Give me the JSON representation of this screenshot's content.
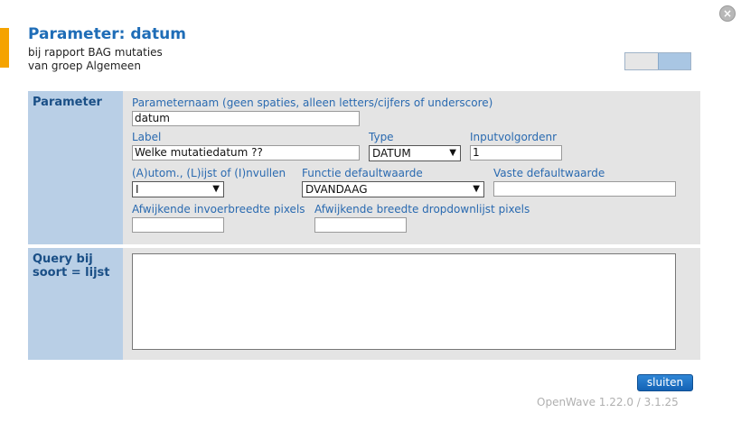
{
  "dialog": {
    "title": "Parameter: datum",
    "subtitle_line1": "bij rapport BAG mutaties",
    "subtitle_line2": "van groep Algemeen",
    "close_glyph": "×"
  },
  "parameter_section": {
    "heading": "Parameter",
    "name_label": "Parameternaam (geen spaties, alleen letters/cijfers of underscore)",
    "name_value": "datum",
    "label_label": "Label",
    "label_value": "Welke mutatiedatum ??",
    "type_label": "Type",
    "type_value": "DATUM",
    "order_label": "Inputvolgordenr",
    "order_value": "1",
    "mode_label": "(A)utom., (L)ijst of (I)nvullen",
    "mode_value": "I",
    "default_fn_label": "Functie defaultwaarde",
    "default_fn_value": "DVANDAAG",
    "fixed_default_label": "Vaste defaultwaarde",
    "fixed_default_value": "",
    "input_width_label": "Afwijkende invoerbreedte pixels",
    "input_width_value": "",
    "dropdown_width_label": "Afwijkende breedte dropdownlijst pixels",
    "dropdown_width_value": ""
  },
  "query_section": {
    "heading_line1": "Query bij",
    "heading_line2": "soort = lijst",
    "query_value": ""
  },
  "footer": {
    "close_button": "sluiten",
    "version": "OpenWave 1.22.0 / 3.1.25"
  },
  "icons": {
    "caret": "▼"
  },
  "colors": {
    "accent": "#f5a300",
    "title": "#1f6db7",
    "label": "#2a6ab0",
    "side_panel": "#b9cfe6",
    "button": "#1f76c8"
  }
}
